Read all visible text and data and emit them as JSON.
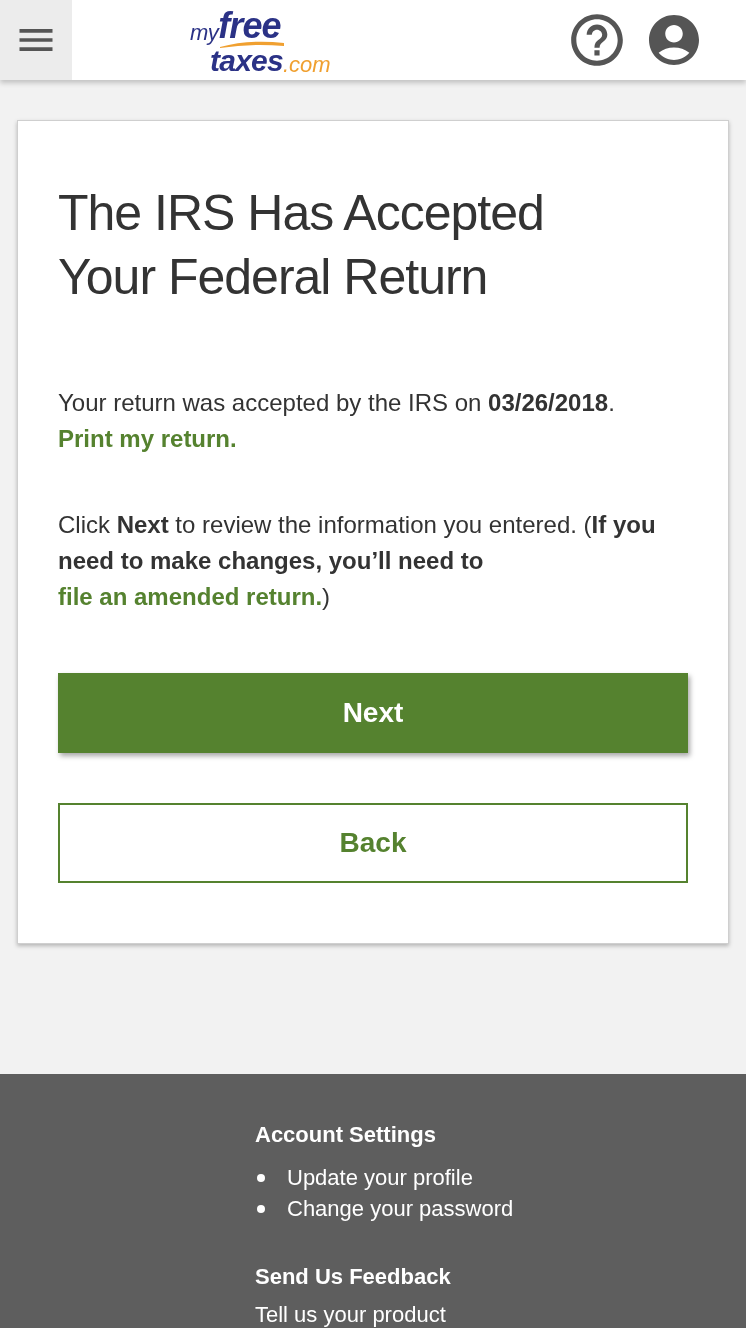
{
  "logo": {
    "top": [
      "my",
      "free"
    ],
    "bottom": [
      "taxes",
      ".com"
    ]
  },
  "card": {
    "title": "The IRS Has Accepted Your Federal Return",
    "paragraphs": [
      {
        "text": "Your return was accepted by the IRS on **03/26/2018**.",
        "link": "Print my return."
      },
      {
        "text": "Click **Next** to review the information you entered. (**If you need to make changes, you’ll need to**",
        "link": "file an amended return.",
        "after": ")"
      }
    ],
    "buttons": [
      {
        "kind": "primary",
        "label": "Next"
      },
      {
        "kind": "secondary",
        "label": "Back"
      }
    ]
  },
  "footer": {
    "sections": [
      {
        "title": "Account Settings",
        "links": [
          "Update your profile",
          "Change your password"
        ]
      },
      {
        "title": "Send Us Feedback",
        "text": "Tell us your product"
      }
    ]
  }
}
